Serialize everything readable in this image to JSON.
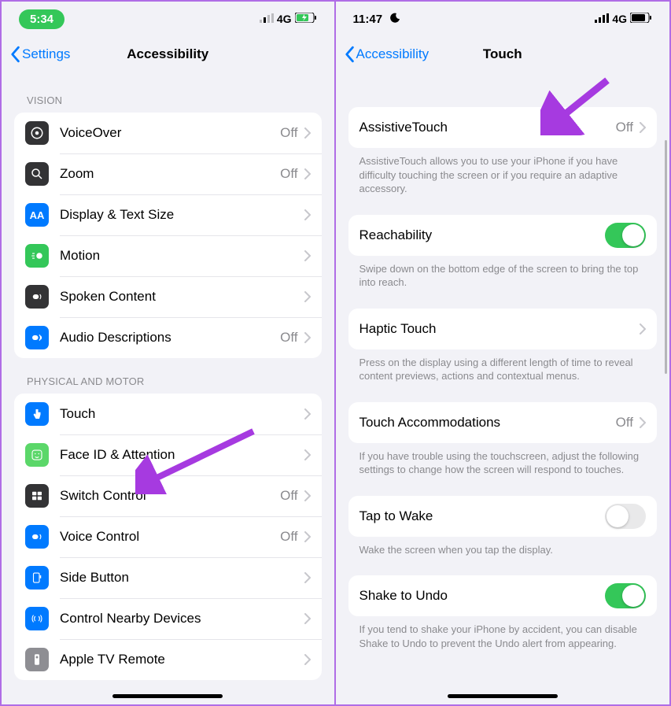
{
  "left": {
    "status": {
      "time": "5:34",
      "net": "4G"
    },
    "nav": {
      "back": "Settings",
      "title": "Accessibility"
    },
    "section_vision": "VISION",
    "vision": [
      {
        "label": "VoiceOver",
        "value": "Off",
        "icon": "voiceover",
        "bg": "dark"
      },
      {
        "label": "Zoom",
        "value": "Off",
        "icon": "zoom",
        "bg": "dark"
      },
      {
        "label": "Display & Text Size",
        "value": "",
        "icon": "textsize",
        "bg": "blue"
      },
      {
        "label": "Motion",
        "value": "",
        "icon": "motion",
        "bg": "green"
      },
      {
        "label": "Spoken Content",
        "value": "",
        "icon": "spoken",
        "bg": "dark"
      },
      {
        "label": "Audio Descriptions",
        "value": "Off",
        "icon": "audiodesc",
        "bg": "blue"
      }
    ],
    "section_motor": "PHYSICAL AND MOTOR",
    "motor": [
      {
        "label": "Touch",
        "value": "",
        "icon": "touch",
        "bg": "blue"
      },
      {
        "label": "Face ID & Attention",
        "value": "",
        "icon": "faceid",
        "bg": "lightgreen"
      },
      {
        "label": "Switch Control",
        "value": "Off",
        "icon": "switch",
        "bg": "dark"
      },
      {
        "label": "Voice Control",
        "value": "Off",
        "icon": "voicecontrol",
        "bg": "blue"
      },
      {
        "label": "Side Button",
        "value": "",
        "icon": "sidebutton",
        "bg": "blue"
      },
      {
        "label": "Control Nearby Devices",
        "value": "",
        "icon": "nearby",
        "bg": "blue"
      },
      {
        "label": "Apple TV Remote",
        "value": "",
        "icon": "tvremote",
        "bg": "gray"
      }
    ]
  },
  "right": {
    "status": {
      "time": "11:47",
      "net": "4G"
    },
    "nav": {
      "back": "Accessibility",
      "title": "Touch"
    },
    "rows": {
      "assistive": {
        "label": "AssistiveTouch",
        "value": "Off"
      },
      "assistive_footer": "AssistiveTouch allows you to use your iPhone if you have difficulty touching the screen or if you require an adaptive accessory.",
      "reachability": {
        "label": "Reachability",
        "on": true
      },
      "reachability_footer": "Swipe down on the bottom edge of the screen to bring the top into reach.",
      "haptic": {
        "label": "Haptic Touch"
      },
      "haptic_footer": "Press on the display using a different length of time to reveal content previews, actions and contextual menus.",
      "tacc": {
        "label": "Touch Accommodations",
        "value": "Off"
      },
      "tacc_footer": "If you have trouble using the touchscreen, adjust the following settings to change how the screen will respond to touches.",
      "tap": {
        "label": "Tap to Wake",
        "on": false
      },
      "tap_footer": "Wake the screen when you tap the display.",
      "shake": {
        "label": "Shake to Undo",
        "on": true
      },
      "shake_footer": "If you tend to shake your iPhone by accident, you can disable Shake to Undo to prevent the Undo alert from appearing."
    }
  }
}
